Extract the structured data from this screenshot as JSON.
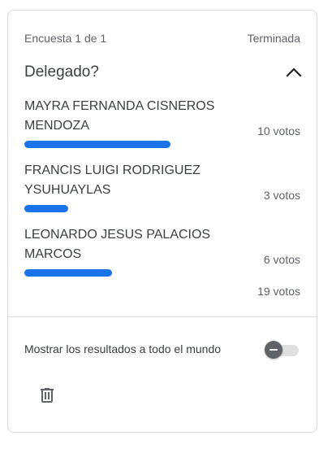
{
  "poll": {
    "counter": "Encuesta 1 de 1",
    "status": "Terminada",
    "question": "Delegado?",
    "options": [
      {
        "name": "MAYRA FERNANDA CISNEROS MENDOZA",
        "votes": "10 votos",
        "share": 0.5263
      },
      {
        "name": "FRANCIS LUIGI RODRIGUEZ YSUHUAYLAS",
        "votes": "3 votos",
        "share": 0.1579
      },
      {
        "name": "LEONARDO JESUS PALACIOS MARCOS",
        "votes": "6 votos",
        "share": 0.3158
      }
    ],
    "total": "19 votos"
  },
  "share": {
    "label": "Mostrar los resultados a todo el mundo",
    "enabled": false
  },
  "icons": {
    "collapse": "chevron-up-icon",
    "delete": "trash-icon"
  },
  "colors": {
    "bar": "#1a73e8",
    "toggle_thumb": "#5f6368",
    "toggle_track": "#e0e0e0"
  }
}
